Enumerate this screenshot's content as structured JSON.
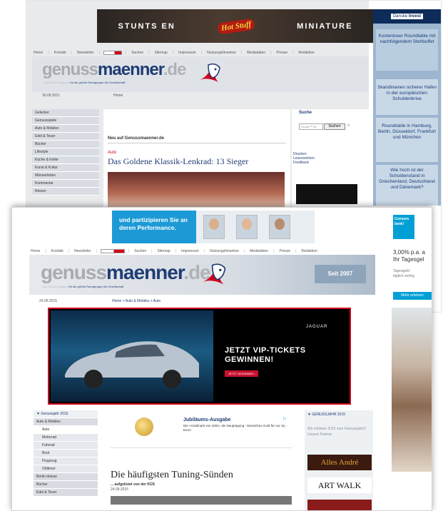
{
  "colors": {
    "navy": "#1f3d74",
    "accent_red": "#d0021b",
    "light_panel": "#dfe3e8",
    "sidebar": "#d9dde3"
  },
  "top_banner": {
    "left": "STUNTS EN",
    "logo": "Hot Stuff",
    "right": "MINIATURE"
  },
  "nav": [
    "Home",
    "Kontakt",
    "Newsletter",
    "Suchen",
    "Sitemap",
    "Impressum",
    "Nutzungshinweise",
    "Mediadaten",
    "Presse",
    "Redaktion"
  ],
  "nav_badge": "",
  "logo": {
    "genuss": "genuss",
    "maenner": "maenner",
    ".de": ".de",
    "tagline_faint": "Das Online-Magazin",
    "tagline": "für die größte Randgruppe der Gesellschaft"
  },
  "screen1": {
    "date": "30.09.2011",
    "breadcrumb": "Home",
    "sidebar": [
      "Gelecker",
      "Genussspiele",
      "Auto & Mobiles",
      "Edel & Teuer",
      "Bücher",
      "Lifestyle",
      "Küche & Keller",
      "Kunst & Kultur",
      "Männerleben",
      "Kommentar",
      "Reisen"
    ],
    "new_heading": "Neu auf Genussmaenner.de",
    "category": "Auto",
    "title": "Das Goldene Klassik-Lenkrad: 13 Sieger",
    "search": {
      "label": "Suche",
      "placeholder": "Google™ Be",
      "button": "Suchen"
    },
    "links": [
      "Drucken",
      "Leserzeichen",
      "Feedback"
    ],
    "right_ad": {
      "brand_a": "Danske",
      "brand_b": "Invest",
      "box1": "Kostenloser Roundtable mit nachfolgendem Stehbuffet",
      "box2": "Skandinavien sicherer Hafen in der europäischen Schuldenkrise",
      "box3": "Roundtable in Hamburg, Berlin, Düsseldorf, Frankfurt und München",
      "box4": "Wie hoch ist der Schuldenstand in Griechenland, Deutschland und Dänemark?"
    }
  },
  "screen2": {
    "promo": "und partizipieren Sie an deren Performance.",
    "seit": "Seit 2007",
    "date": "24.09.2015",
    "breadcrumb": "Home > Auto & Mobiles > Auto",
    "jaguar": {
      "brand": "JAGUAR",
      "headline1": "JETZT VIP-TICKETS",
      "headline2": "GEWINNEN!",
      "cta": "JETZT GEWINNEN ›"
    },
    "sidebar": [
      {
        "label": "▼ Genussjahr 2015",
        "active": false,
        "indent": false
      },
      {
        "label": "Auto & Mobiles",
        "active": false,
        "indent": false
      },
      {
        "label": "Auto",
        "active": true,
        "indent": true
      },
      {
        "label": "Motorrad",
        "active": false,
        "indent": true
      },
      {
        "label": "Fahrrad",
        "active": false,
        "indent": true
      },
      {
        "label": "Boot",
        "active": false,
        "indent": true
      },
      {
        "label": "Flugzeug",
        "active": false,
        "indent": true
      },
      {
        "label": "Oldtimer",
        "active": false,
        "indent": true
      },
      {
        "label": "Berlin deluxe",
        "active": false,
        "indent": false
      },
      {
        "label": "Bücher",
        "active": false,
        "indent": false
      },
      {
        "label": "Edel & Teuer",
        "active": false,
        "indent": false
      }
    ],
    "coin_ad": {
      "title": "Jubiläums-Ausgabe",
      "text": "Die »Goldmark von 2001« als Neuprägung - Deutsches Gold für nur 15,- Euro!"
    },
    "article": {
      "title": "Die häufigsten Tuning-Sünden",
      "subtitle": "... aufgelistet von der KÜS",
      "date": "24.09.2015"
    },
    "right_col": {
      "heading": "▼ GENUSSJAHR 2015",
      "text": "Wir erklären 2015 zum Genuss(jahr)! Unsere Partner:",
      "alles": "Alles André",
      "artwalk": "ART WALK"
    },
    "consors": {
      "brand": "Consors bank!",
      "rate": "3,00% p.a. a",
      "sub": "Ihr Tagesgel",
      "small1": "Tagesgeld",
      "small2": "täglich verfüg",
      "btn": "Mehr erfahren"
    }
  }
}
